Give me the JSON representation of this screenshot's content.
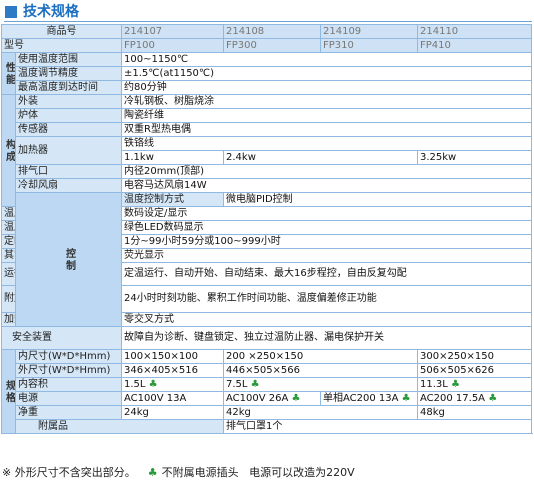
{
  "header": {
    "title": "技术规格"
  },
  "models": {
    "label_item": "商品号",
    "label_model": "型号",
    "items": [
      "214107",
      "214108",
      "214109",
      "214110"
    ],
    "names": [
      "FP100",
      "FP300",
      "FP310",
      "FP410"
    ]
  },
  "performance": {
    "group": "性能",
    "range_label": "使用温度范围",
    "range_value": "100~1150℃",
    "precision_label": "温度调节精度",
    "precision_value": "±1.5℃(at1150℃)",
    "time_label": "最高温度到达时间",
    "time_value": "约80分钟"
  },
  "construction": {
    "group": "构成",
    "exterior_label": "外装",
    "exterior_value": "冷轧钢板、树脂烧涂",
    "furnace_label": "炉体",
    "furnace_value": "陶瓷纤维",
    "sensor_label": "传感器",
    "sensor_value": "双重R型热电偶",
    "heater_label": "加热器",
    "heater_value": "铁铬线",
    "heater_powers": [
      "1.1kw",
      "2.4kw",
      "3.25kw"
    ],
    "exhaust_label": "排气口",
    "exhaust_value": "内径20mm(顶部)",
    "fan_label": "冷却风扇",
    "fan_value": "电容马达风扇14W"
  },
  "control": {
    "group": "控制",
    "method_label": "温度控制方式",
    "method_value": "微电脑PID控制",
    "set_label": "温度设定/显示",
    "set_value": "数码设定/显示",
    "display_label": "温度显示方式",
    "display_value": "绿色LED数码显示",
    "timer_label": "定时显示范围",
    "timer_value": "1分~99小时59分或100~999小时",
    "other_label": "其它显示",
    "other_value": "荧光显示",
    "run_label": "运行/操作功能",
    "run_value": "定温运行、自动开始、自动结束、最大16步程控，自由反复勾配",
    "extra_label": "附加功能",
    "extra_value": "24小时时刻功能、累积工作时间功能、温度偏差修正功能",
    "heater_circuit_label": "加热器回路控制",
    "heater_circuit_value": "零交叉方式"
  },
  "safety": {
    "label": "安全装置",
    "value": "故障自为诊断、键盘锁定、独立过温防止器、漏电保护开关"
  },
  "specs": {
    "group": "规格",
    "inner_label": "内尺寸(W*D*Hmm)",
    "inner_values": [
      "100×150×100",
      "200 ×250×150",
      "300×250×150"
    ],
    "outer_label": "外尺寸(W*D*Hmm)",
    "outer_values": [
      "346×405×516",
      "446×505×566",
      "506×505×626"
    ],
    "volume_label": "内容积",
    "volume_values": [
      "1.5L",
      "7.5L",
      "11.3L"
    ],
    "power_label": "电源",
    "power_values": [
      "AC100V 13A",
      "AC100V 26A",
      "单相AC200 13A",
      "AC200 17.5A"
    ],
    "weight_label": "净重",
    "weight_values": [
      "24kg",
      "42kg",
      "48kg"
    ]
  },
  "accessory": {
    "label": "附属品",
    "value": "排气口罩1个"
  },
  "footnote": {
    "text1": "※ 外形尺寸不含突出部分。",
    "text2": "不附属电源插头",
    "text3": "电源可以改造为220V"
  },
  "colors": {
    "accent": "#2d7ac7",
    "label_bg": "#d5e7f7",
    "group_bg": "#bcd8f2",
    "border": "#8fb9e0",
    "note_green": "#2a9a3a"
  }
}
